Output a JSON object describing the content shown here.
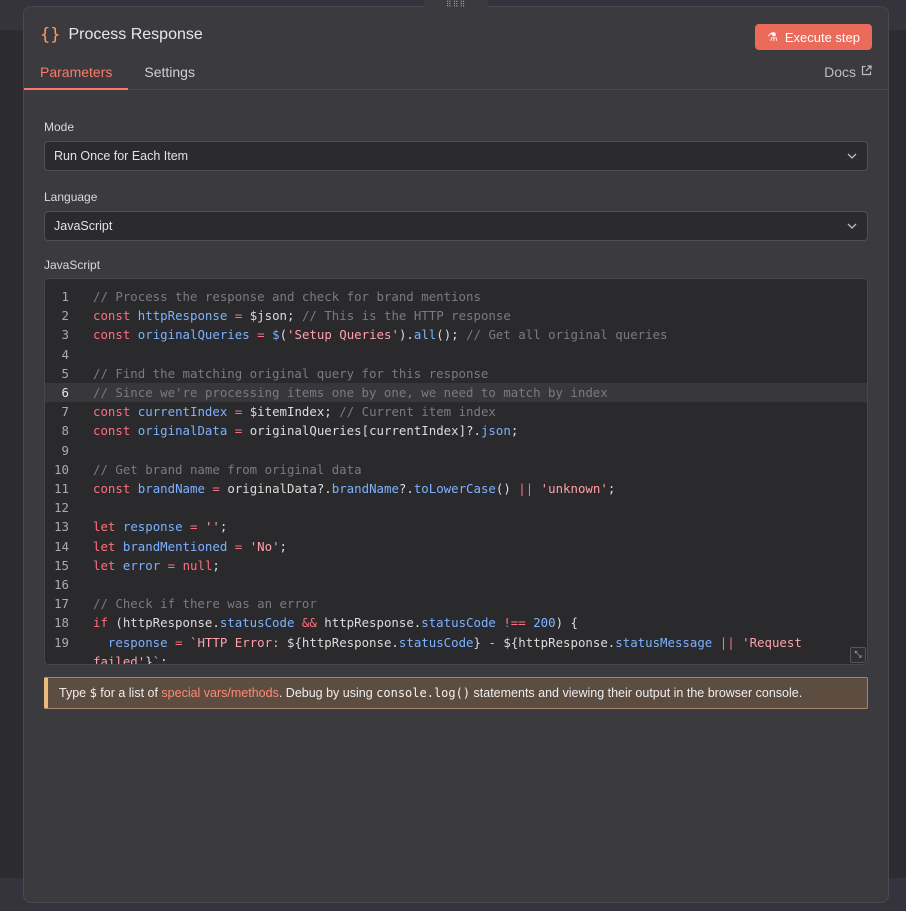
{
  "node": {
    "title": "Process Response",
    "icon": "braces-icon",
    "execute_label": "Execute step"
  },
  "tabs": [
    {
      "label": "Parameters",
      "active": true
    },
    {
      "label": "Settings",
      "active": false
    }
  ],
  "docs_label": "Docs",
  "mode": {
    "label": "Mode",
    "value": "Run Once for Each Item"
  },
  "language": {
    "label": "Language",
    "value": "JavaScript"
  },
  "editor": {
    "label": "JavaScript",
    "active_line": 6,
    "line_numbers": [
      "1",
      "2",
      "3",
      "4",
      "5",
      "6",
      "7",
      "8",
      "9",
      "10",
      "11",
      "12",
      "13",
      "14",
      "15",
      "16",
      "17",
      "18",
      "19"
    ]
  },
  "hint": {
    "prefix": "Type ",
    "dollar": "$",
    "middle": " for a list of ",
    "link": "special vars/methods",
    "after_link": ". Debug by using ",
    "code": "console.log()",
    "suffix": " statements and viewing their output in the browser console."
  },
  "colors": {
    "accent": "#ff7a66",
    "execute_button": "#ec6a59",
    "hint_border": "#e8ba7c"
  }
}
